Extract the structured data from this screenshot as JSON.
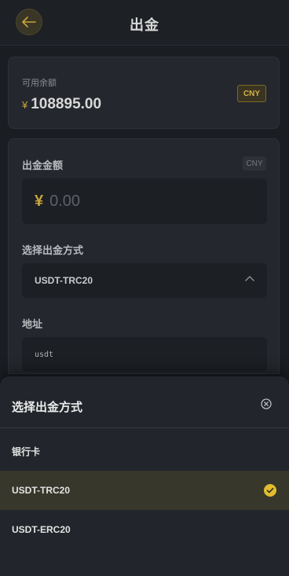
{
  "header": {
    "title": "出金"
  },
  "balance": {
    "label": "可用余额",
    "currency_symbol": "¥",
    "value": "108895.00",
    "currency": "CNY"
  },
  "form": {
    "amount_label": "出金金额",
    "amount_currency": "CNY",
    "amount_symbol": "¥",
    "amount_placeholder": "0.00",
    "method_label": "选择出金方式",
    "method_value": "USDT-TRC20",
    "address_label": "地址",
    "address_value": "usdt"
  },
  "sheet": {
    "title": "选择出金方式",
    "options": [
      {
        "label": "银行卡",
        "selected": false
      },
      {
        "label": "USDT-TRC20",
        "selected": true
      },
      {
        "label": "USDT-ERC20",
        "selected": false
      }
    ]
  },
  "colors": {
    "accent": "#c9a33a",
    "background": "#1a1d21",
    "card": "#24272d",
    "selected_row": "#38372b"
  },
  "icons": {
    "back": "arrow-left-icon",
    "chevron": "chevron-up-icon",
    "close": "close-circle-icon",
    "check": "check-circle-icon"
  }
}
